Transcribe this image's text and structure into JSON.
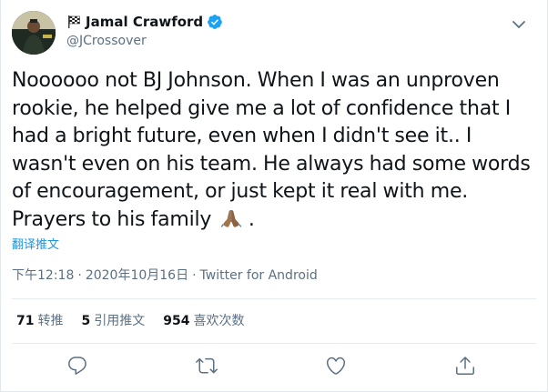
{
  "user": {
    "name": "Jamal Crawford",
    "handle": "@JCrossover",
    "avatar_icon": "avatar-photo",
    "flag_icon": "checkered-flag-icon",
    "verified_icon": "verified-badge-icon",
    "verified_color": "#1da1f2"
  },
  "tweet": {
    "text": "Noooooo not BJ Johnson. When I was an unproven rookie, he helped give me a lot of confidence that I had a bright future, even when I didn't see it.. I wasn't even on his team. He always had some words of encouragement, or just kept it real with me. Prayers to his family",
    "emoji": "folded-hands-emoji",
    "trailing": " .",
    "translate_label": "翻译推文"
  },
  "meta": {
    "time": "下午12:18",
    "separator": "·",
    "date": "2020年10月16日",
    "source": "Twitter for Android"
  },
  "stats": [
    {
      "count": "71",
      "label": "转推"
    },
    {
      "count": "5",
      "label": "引用推文"
    },
    {
      "count": "954",
      "label": "喜欢次数"
    }
  ],
  "actions": [
    {
      "icon": "reply-icon"
    },
    {
      "icon": "retweet-icon"
    },
    {
      "icon": "like-icon"
    },
    {
      "icon": "share-icon"
    }
  ],
  "colors": {
    "text": "#0f1419",
    "secondary": "#5b7083",
    "link": "#1b95e0",
    "divider": "#e6ecf0"
  }
}
